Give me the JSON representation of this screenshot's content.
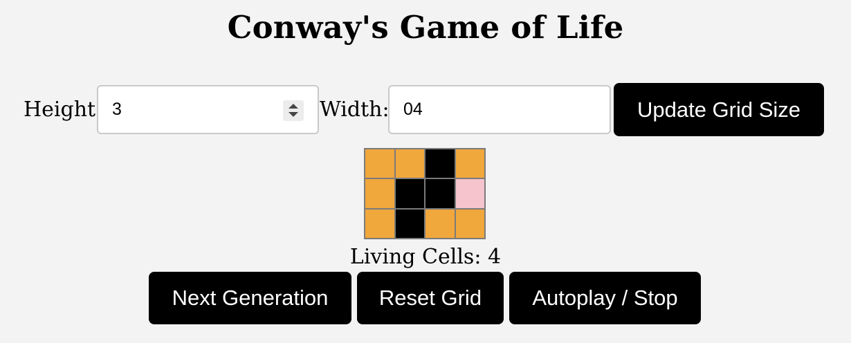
{
  "title": "Conway's Game of Life",
  "controls": {
    "height_label": "Height:",
    "height_value": "3",
    "width_label": "Width:",
    "width_value": "04",
    "update_button": "Update Grid Size"
  },
  "grid": {
    "rows": 3,
    "cols": 4,
    "cells": [
      [
        "dead",
        "dead",
        "alive",
        "dead"
      ],
      [
        "dead",
        "alive",
        "alive",
        "hover"
      ],
      [
        "dead",
        "alive",
        "dead",
        "dead"
      ]
    ],
    "colors": {
      "dead": "#f0a73c",
      "alive": "#000000",
      "hover": "#f5c4cd",
      "border": "#7b7b7b"
    }
  },
  "status": {
    "living_label": "Living Cells:",
    "living_count": "4"
  },
  "actions": {
    "next_generation": "Next Generation",
    "reset_grid": "Reset Grid",
    "autoplay_stop": "Autoplay / Stop"
  },
  "icons": {
    "height_spinner": "spinner-arrows-icon"
  }
}
